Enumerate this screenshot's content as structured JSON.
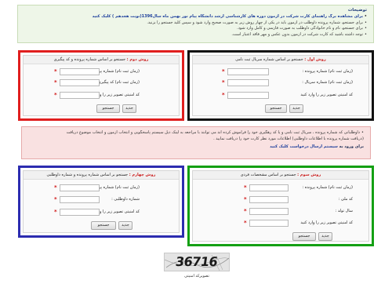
{
  "notice": {
    "title": "توضیحات",
    "items": [
      "برای مشاهده برگ راهنمای کارت شرکت در آزمون دوره های کارشناسی ارشد دانشگاه پیام نور بهمن ماه سال1396(نوبت هجدهم ) کلیک کنید",
      "برای جستجو، شماره پرونده داوطلب در آزمون باید در یکی از چهار روش زیر به صورت صحیح وارد شود و سپس کلید جستجو را بزنید.",
      "برای جستجو، نام و نام خانوادگی داوطلب به صورت فارسی و کامل وارد شود.",
      "توجه داشته باشید که کارت شرکت در آزمون بدون عکس و مهر فاقد اعتبار است."
    ]
  },
  "panel1": {
    "tag": "روش اول :",
    "title": "جستجو بر اساس شماره سریال ثبت نامی",
    "fields": [
      {
        "label": "(زمان ثبت نام) شماره پرونده :"
      },
      {
        "label": "(زمان ثبت نام) شماره سریال :"
      },
      {
        "label": "کد امنیتی تصویر زیر را وارد کنید"
      }
    ],
    "search_label": "جستجو",
    "new_label": "جدید"
  },
  "panel2": {
    "tag": "روش دوم :",
    "title": "جستجو بر اساس شماره پرونده و کد پیگیری",
    "fields": [
      {
        "label": "(زمان ثبت نام) شماره پرونده :"
      },
      {
        "label": "(زمان ثبت نام) کد پیگیری :"
      },
      {
        "label": "کد امنیتی تصویر زیر را وارد کنید"
      }
    ],
    "search_label": "جستجو",
    "new_label": "جدید"
  },
  "warning": {
    "items": [
      "داوطلبانی که شماره پرونده ، سریال ثبت نامی و یا کد رهگیری خود را فراموش کرده اند می توانند با مراجعه به لینک ذیل سیستم پاسخگویی و انتخاب آزمون و انتخاب موضوع دریافت",
      "(دریافت شماره پرونده با اطلاعات داوطلبی) اطلاعات مورد نظر کارت خود را دریافت نمایید ."
    ],
    "link_prefix": "برای ورود به",
    "link_text": "سیستم ارسال درخواست کلیک کنید"
  },
  "panel3": {
    "tag": "روش سوم :",
    "title": "جستجو بر اساس مشخصات فردی",
    "fields": [
      {
        "label": "(زمان ثبت نام) شماره پرونده :"
      },
      {
        "label": "کد ملی :"
      },
      {
        "label": "سال تولد :"
      },
      {
        "label": "کد امنیتی تصویر زیر را وارد کنید"
      }
    ],
    "search_label": "جستجو",
    "new_label": "جدید"
  },
  "panel4": {
    "tag": "روش چهارم :",
    "title": "جستجو بر اساس شماره پرونده و شماره داوطلبی",
    "fields": [
      {
        "label": "(زمان ثبت نام) شماره پرونده :"
      },
      {
        "label": "شماره داوطلبی :"
      },
      {
        "label": "کد امنیتی تصویر زیر را وارد کنید"
      }
    ],
    "search_label": "جستجو",
    "new_label": "جدید"
  },
  "captcha": {
    "code": "36716",
    "label": "تصویرکد امنیتی"
  },
  "colors": {
    "panel1_border": "#111111",
    "panel2_border": "#e01e1e",
    "panel3_border": "#14a014",
    "panel4_border": "#2c2cb0",
    "required": "#d01515",
    "notice_bg": "#eef6e8",
    "warning_bg": "#f9e1e1"
  }
}
